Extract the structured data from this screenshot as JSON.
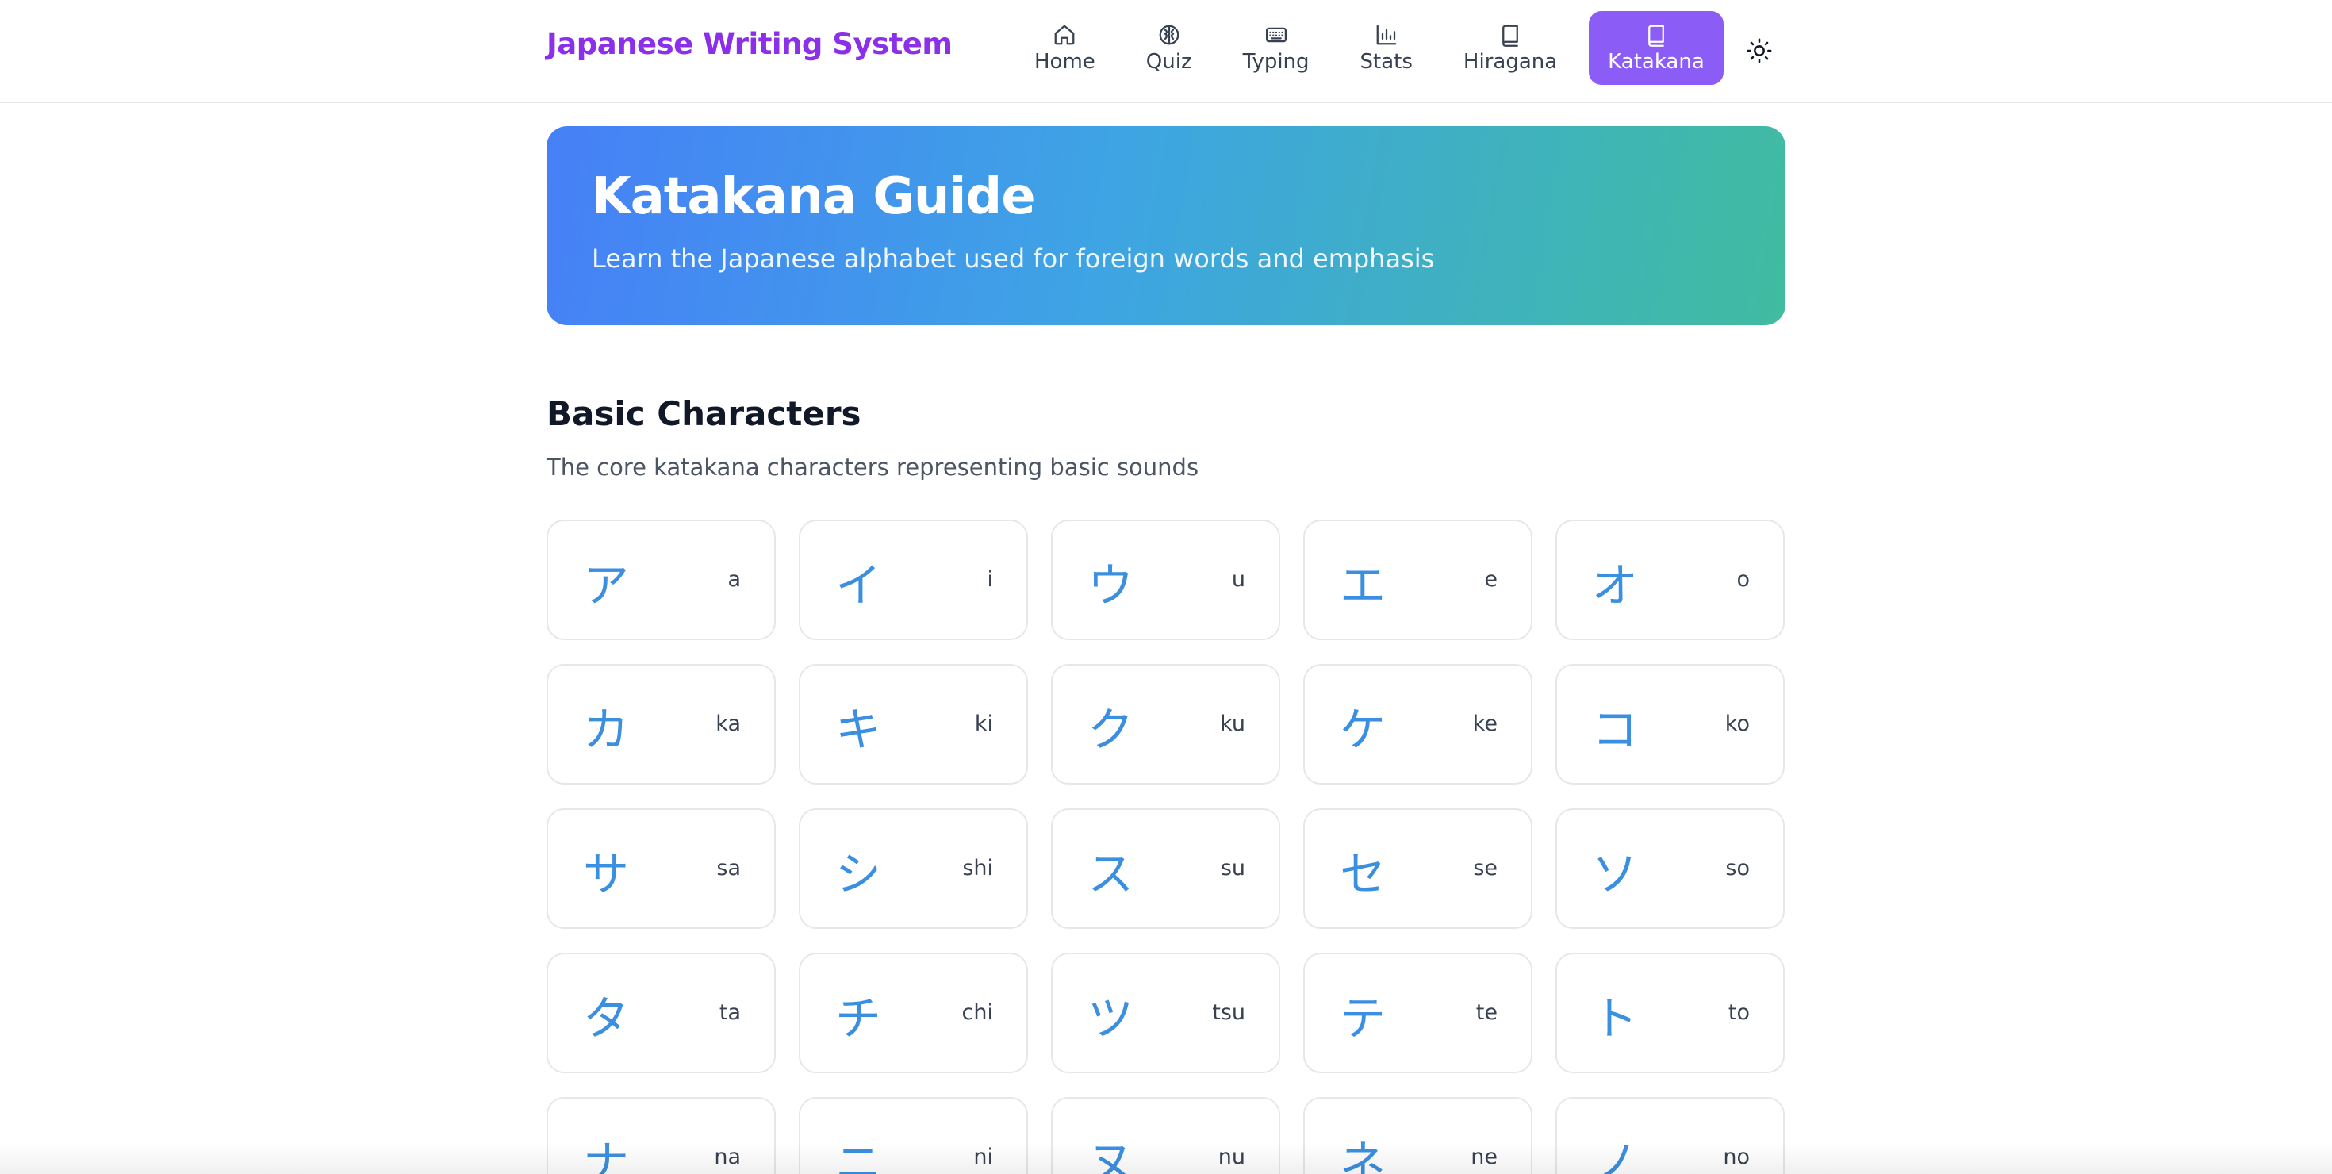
{
  "header": {
    "brand": "Japanese Writing System",
    "nav": [
      {
        "label": "Home",
        "icon": "home-icon",
        "active": false
      },
      {
        "label": "Quiz",
        "icon": "brain-icon",
        "active": false
      },
      {
        "label": "Typing",
        "icon": "keyboard-icon",
        "active": false
      },
      {
        "label": "Stats",
        "icon": "bar-chart-icon",
        "active": false
      },
      {
        "label": "Hiragana",
        "icon": "book-icon",
        "active": false
      },
      {
        "label": "Katakana",
        "icon": "book-icon",
        "active": true
      }
    ],
    "theme_toggle_icon": "sun-icon"
  },
  "hero": {
    "title": "Katakana Guide",
    "subtitle": "Learn the Japanese alphabet used for foreign words and emphasis"
  },
  "section": {
    "title": "Basic Characters",
    "description": "The core katakana characters representing basic sounds",
    "characters": [
      {
        "kana": "ア",
        "romaji": "a"
      },
      {
        "kana": "イ",
        "romaji": "i"
      },
      {
        "kana": "ウ",
        "romaji": "u"
      },
      {
        "kana": "エ",
        "romaji": "e"
      },
      {
        "kana": "オ",
        "romaji": "o"
      },
      {
        "kana": "カ",
        "romaji": "ka"
      },
      {
        "kana": "キ",
        "romaji": "ki"
      },
      {
        "kana": "ク",
        "romaji": "ku"
      },
      {
        "kana": "ケ",
        "romaji": "ke"
      },
      {
        "kana": "コ",
        "romaji": "ko"
      },
      {
        "kana": "サ",
        "romaji": "sa"
      },
      {
        "kana": "シ",
        "romaji": "shi"
      },
      {
        "kana": "ス",
        "romaji": "su"
      },
      {
        "kana": "セ",
        "romaji": "se"
      },
      {
        "kana": "ソ",
        "romaji": "so"
      },
      {
        "kana": "タ",
        "romaji": "ta"
      },
      {
        "kana": "チ",
        "romaji": "chi"
      },
      {
        "kana": "ツ",
        "romaji": "tsu"
      },
      {
        "kana": "テ",
        "romaji": "te"
      },
      {
        "kana": "ト",
        "romaji": "to"
      },
      {
        "kana": "ナ",
        "romaji": "na"
      },
      {
        "kana": "ニ",
        "romaji": "ni"
      },
      {
        "kana": "ヌ",
        "romaji": "nu"
      },
      {
        "kana": "ネ",
        "romaji": "ne"
      },
      {
        "kana": "ノ",
        "romaji": "no"
      }
    ]
  },
  "colors": {
    "brand": "#8b2fe8",
    "active_nav": "#8b5cf6",
    "kana": "#3b8fe0",
    "hero_gradient_start": "#4680f7",
    "hero_gradient_end": "#40bca0"
  }
}
